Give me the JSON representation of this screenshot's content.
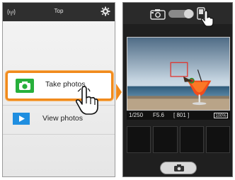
{
  "left_screen": {
    "header": {
      "title": "Top",
      "wifi_icon": "wifi-signal-icon",
      "settings_icon": "gear-icon"
    },
    "menu": [
      {
        "label": "Take photos",
        "icon": "camera-icon",
        "selected": true
      },
      {
        "label": "View photos",
        "icon": "play-icon",
        "selected": false
      }
    ]
  },
  "right_screen": {
    "header": {
      "mode_icon": "camera-mode-icon",
      "remote_icon": "remote-icon"
    },
    "info": {
      "shutter_speed": "1/250",
      "aperture": "F5.6",
      "shots": "[ 801 ]",
      "battery": "100%"
    },
    "shutter_icon": "camera-shutter-icon"
  },
  "colors": {
    "highlight": "#f08a1c",
    "camera_green": "#27b03b",
    "play_blue": "#1f8ee0"
  }
}
